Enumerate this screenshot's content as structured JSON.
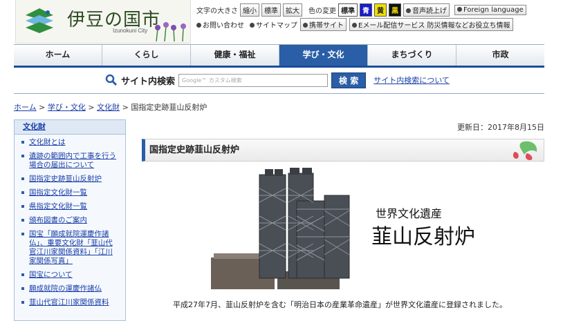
{
  "header": {
    "logo_title": "伊豆の国市",
    "logo_sub": "Izunokuni City",
    "font_size_label": "文字の大きさ",
    "font_sizes": [
      "縮小",
      "標準",
      "拡大"
    ],
    "color_label": "色の変更",
    "colors": [
      {
        "label": "標準",
        "bg": "#ffffff",
        "fg": "#222222"
      },
      {
        "label": "青",
        "bg": "#1a1acc",
        "fg": "#ffffff"
      },
      {
        "label": "黄",
        "bg": "#f0e000",
        "fg": "#222222"
      },
      {
        "label": "黒",
        "bg": "#111111",
        "fg": "#f0e000"
      }
    ],
    "speech_label": "音声読上げ",
    "foreign_label": "Foreign language",
    "contact_label": "お問い合わせ",
    "sitemap_label": "サイトマップ",
    "mobile_label": "携帯サイト",
    "email_label": "Eメール配信サービス",
    "disaster_label": "防災情報などお役立ち情報"
  },
  "nav": [
    "ホーム",
    "くらし",
    "健康・福祉",
    "学び・文化",
    "まちづくり",
    "市政"
  ],
  "search": {
    "label": "サイト内検索",
    "placeholder": "Google™ カスタム検索",
    "button": "検 索",
    "about": "サイト内検索について"
  },
  "breadcrumb": {
    "items": [
      "ホーム",
      "学び・文化",
      "文化財"
    ],
    "sep": " > ",
    "current": "国指定史跡韮山反射炉"
  },
  "sidebar": {
    "heading": "文化財",
    "items": [
      "文化財とは",
      "遺跡の範囲内で工事を行う場合の届出について",
      "国指定史跡韮山反射炉",
      "国指定文化財一覧",
      "県指定文化財一覧",
      "頒布図書のご案内",
      "国宝「願成就院運慶作諸仏」、重要文化財「韮山代官江川家関係資料」「江川家関係写真」",
      "国宝について",
      "願成就院の運慶作諸仏",
      "韮山代官江川家関係資料"
    ]
  },
  "main": {
    "updated": "更新日：2017年8月15日",
    "title": "国指定史跡韮山反射炉",
    "photo_text_small": "世界文化遺産",
    "photo_text_big": "韮山反射炉",
    "caption": "平成27年7月、韮山反射炉を含む「明治日本の産業革命遺産」が世界文化遺産に登録されました。"
  }
}
